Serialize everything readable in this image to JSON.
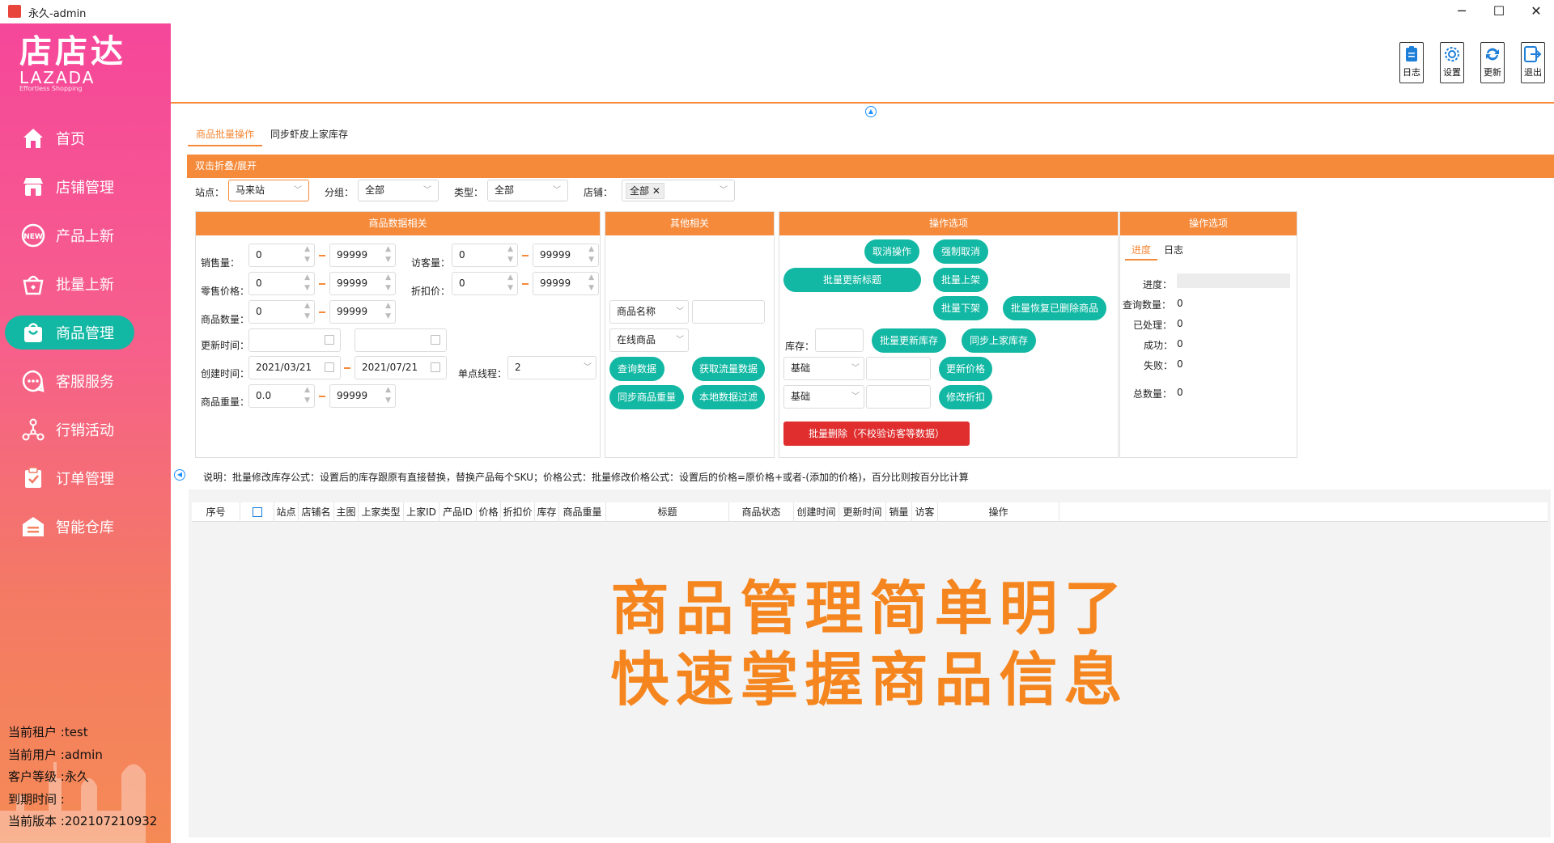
{
  "window": {
    "title": "永久-admin",
    "minimize": "─",
    "maximize": "☐",
    "close": "✕"
  },
  "brand": {
    "name": "店店达",
    "lazada": "LAZADA",
    "slogan": "Effortless Shopping"
  },
  "nav": [
    {
      "label": "首页",
      "icon": "home-icon"
    },
    {
      "label": "店铺管理",
      "icon": "store-icon"
    },
    {
      "label": "产品上新",
      "icon": "new-badge-icon"
    },
    {
      "label": "批量上新",
      "icon": "basket-icon"
    },
    {
      "label": "商品管理",
      "icon": "shopping-bag-icon",
      "active": true
    },
    {
      "label": "客服服务",
      "icon": "chat-icon"
    },
    {
      "label": "行销活动",
      "icon": "network-icon"
    },
    {
      "label": "订单管理",
      "icon": "clipboard-check-icon"
    },
    {
      "label": "智能仓库",
      "icon": "warehouse-icon"
    }
  ],
  "user": {
    "tenant": "当前租户 :test",
    "user": "当前用户 :admin",
    "level": "客户等级 :永久",
    "expire": "到期时间 :",
    "version": "当前版本 :202107210932"
  },
  "toolbar": {
    "log": "日志",
    "settings": "设置",
    "update": "更新",
    "exit": "退出"
  },
  "tabs": {
    "batch": "商品批量操作",
    "sync": "同步虾皮上家库存"
  },
  "fold": "双击折叠/展开",
  "filters": {
    "site_label": "站点：",
    "site": "马来站",
    "group_label": "分组：",
    "group": "全部",
    "type_label": "类型：",
    "type": "全部",
    "shop_label": "店铺：",
    "shop": "全部"
  },
  "panel_data": {
    "title": "商品数据相关",
    "sales_label": "销售量：",
    "sales_min": "0",
    "sales_max": "99999",
    "visits_label": "访客量：",
    "visits_min": "0",
    "visits_max": "99999",
    "retail_label": "零售价格：",
    "retail_min": "0",
    "retail_max": "99999",
    "discount_label": "折扣价：",
    "discount_min": "0",
    "discount_max": "99999",
    "qty_label": "商品数量：",
    "qty_min": "0",
    "qty_max": "99999",
    "updated_label": "更新时间：",
    "created_label": "创建时间：",
    "created_from": "2021/03/21",
    "created_to": "2021/07/21",
    "threads_label": "单点线程：",
    "threads": "2",
    "weight_label": "商品重量：",
    "weight_min": "0.0",
    "weight_max": "99999"
  },
  "panel_other": {
    "title": "其他相关",
    "field": "商品名称",
    "status": "在线商品",
    "query": "查询数据",
    "traffic": "获取流量数据",
    "sync_weight": "同步商品重量",
    "local_filter": "本地数据过滤"
  },
  "panel_ops": {
    "title": "操作选项",
    "cancel": "取消操作",
    "force_cancel": "强制取消",
    "update_title": "批量更新标题",
    "list": "批量上架",
    "delist": "批量下架",
    "restore": "批量恢复已删除商品",
    "stock_label": "库存：",
    "update_stock": "批量更新库存",
    "sync_stock": "同步上家库存",
    "base1": "基础",
    "update_price": "更新价格",
    "base2": "基础",
    "edit_discount": "修改折扣",
    "delete": "批量删除（不校验访客等数据）"
  },
  "panel_progress": {
    "title": "操作选项",
    "tab_progress": "进度",
    "tab_log": "日志",
    "progress_label": "进度：",
    "query_label": "查询数量：",
    "query_val": "0",
    "processed_label": "已处理：",
    "processed_val": "0",
    "success_label": "成功：",
    "success_val": "0",
    "fail_label": "失败：",
    "fail_val": "0",
    "total_label": "总数量：",
    "total_val": "0"
  },
  "note": "说明：批量修改库存公式：设置后的库存跟原有直接替换，替换产品每个SKU；价格公式：批量修改价格公式：设置后的价格=原价格+或者-(添加的价格)，百分比则按百分比计算",
  "columns": [
    "序号",
    "",
    "站点",
    "店铺名",
    "主图",
    "上家类型",
    "上家ID",
    "产品ID",
    "价格",
    "折扣价",
    "库存",
    "商品重量",
    "标题",
    "商品状态",
    "创建时间",
    "更新时间",
    "销量",
    "访客",
    "操作"
  ],
  "promo": {
    "line1": "商品管理简单明了",
    "line2": "快速掌握商品信息"
  },
  "colors": {
    "accent": "#f58a3a",
    "teal": "#12b8a3",
    "danger": "#e02e2e",
    "promo": "#f5861f"
  }
}
